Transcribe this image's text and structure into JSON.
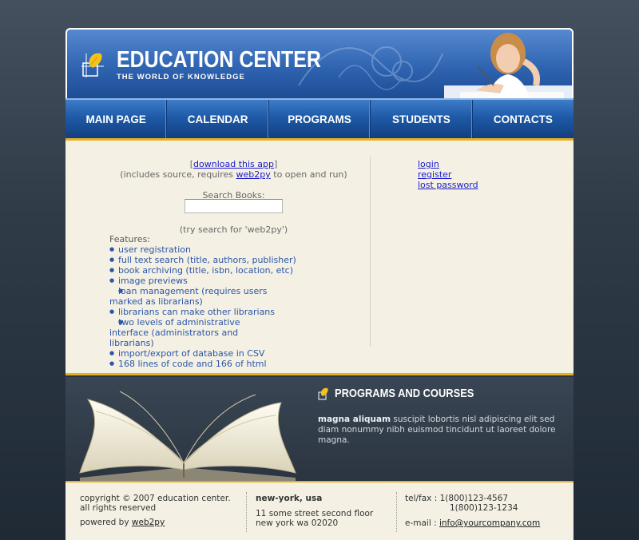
{
  "header": {
    "title": "EDUCATION CENTER",
    "subtitle": "THE WORLD OF KNOWLEDGE"
  },
  "nav": {
    "items": [
      {
        "label": "MAIN PAGE"
      },
      {
        "label": "CALENDAR"
      },
      {
        "label": "PROGRAMS"
      },
      {
        "label": "STUDENTS"
      },
      {
        "label": "CONTACTS"
      }
    ]
  },
  "main": {
    "download_prefix": "[",
    "download_link": "download this app",
    "download_suffix": "]",
    "includes_prefix": "(includes source, requires ",
    "includes_link": "web2py",
    "includes_suffix": " to open and run)",
    "search_label": "Search Books:",
    "search_value": "",
    "try_text": "(try search for 'web2py')",
    "features_title": "Features:",
    "features": [
      "user registration",
      "full text search (title, authors, publisher)",
      "book archiving (title, isbn, location, etc)",
      "image previews",
      "loan management (requires users marked as librarians)",
      "librarians can make other librarians",
      "two levels of administrative interface (administrators and librarians)",
      "import/export of database in CSV",
      "168 lines of code and 166 of html"
    ]
  },
  "account": {
    "login": "login",
    "register": "register",
    "lost_password": "lost password"
  },
  "programs": {
    "title": "PROGRAMS AND COURSES",
    "lead": "magna aliquam",
    "text": " suscipit lobortis nisl adipiscing elit sed diam nonummy nibh euismod tincidunt ut laoreet dolore magna."
  },
  "footer": {
    "copyright": "copyright © 2007 education center. all rights reserved",
    "powered_prefix": "powered by ",
    "powered_link": "web2py",
    "city": "new-york, usa",
    "address1": "11 some street second floor",
    "address2": "new york wa 02020",
    "tel_label": "tel/fax :",
    "tel1": "1(800)123-4567",
    "tel2": "1(800)123-1234",
    "email_label": "e-mail :",
    "email": "info@yourcompany.com"
  },
  "colors": {
    "accent": "#e8b020",
    "header_blue": "#2f64b1",
    "link_blue": "#1a1acc",
    "feature_blue": "#2a55a8",
    "band_dark": "#2b3541"
  }
}
